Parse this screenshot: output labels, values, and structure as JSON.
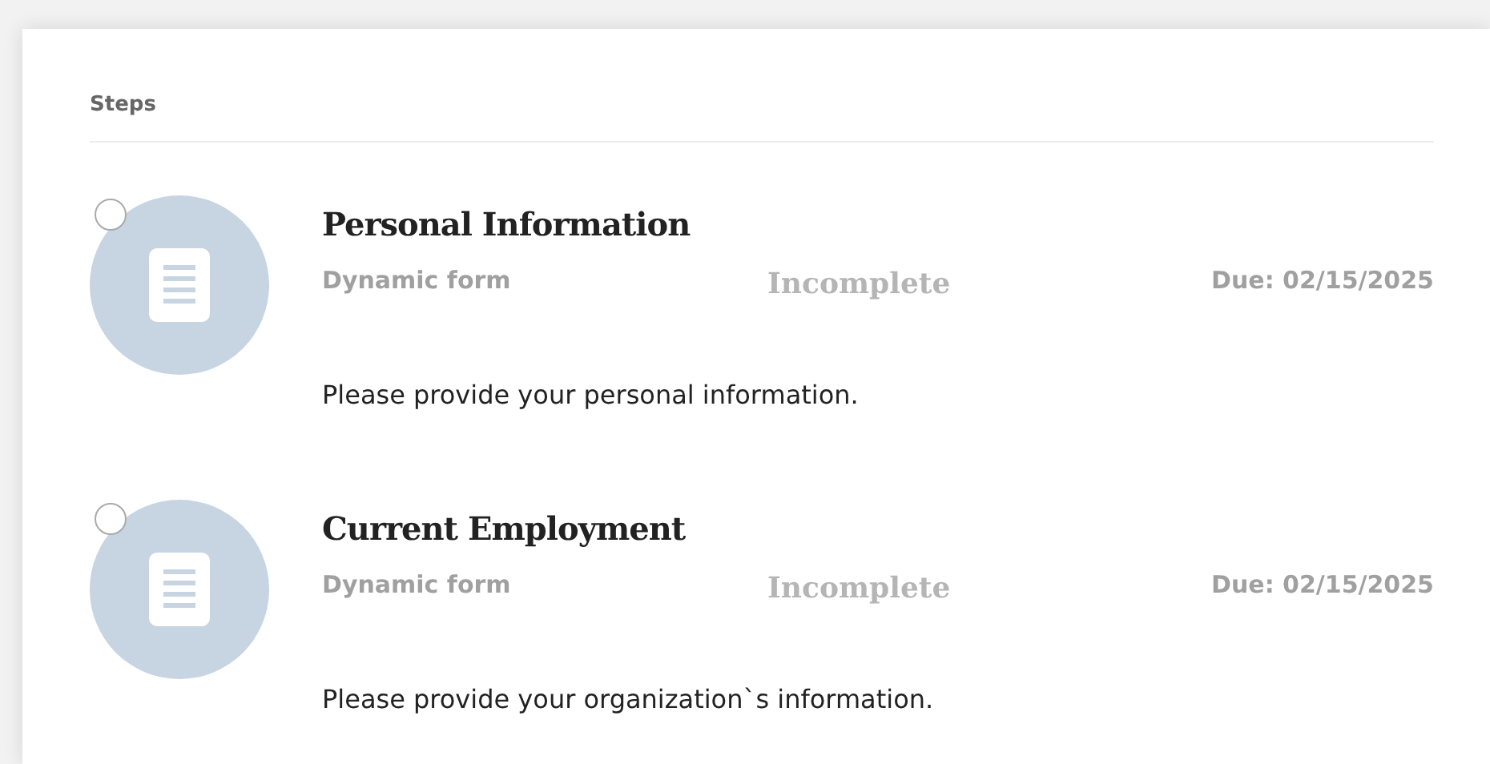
{
  "section_title": "Steps",
  "steps": [
    {
      "title": "Personal Information",
      "type": "Dynamic form",
      "status": "Incomplete",
      "due": "Due: 02/15/2025",
      "description": "Please provide your personal information.",
      "selected": false
    },
    {
      "title": "Current Employment",
      "type": "Dynamic form",
      "status": "Incomplete",
      "due": "Due: 02/15/2025",
      "description": "Please provide your organization`s information.",
      "selected": false
    }
  ]
}
